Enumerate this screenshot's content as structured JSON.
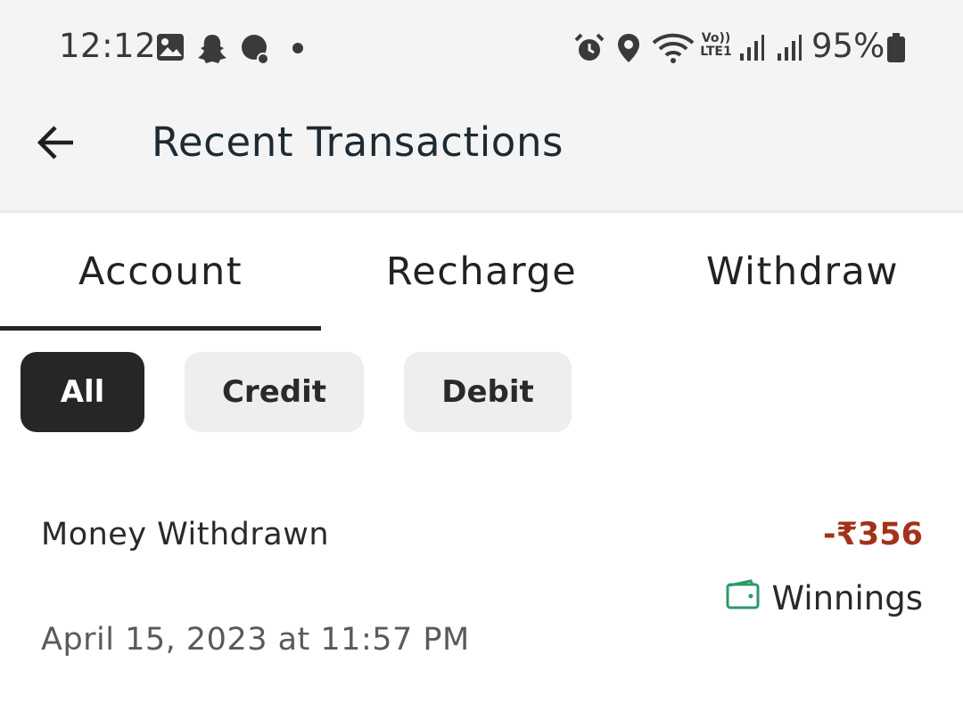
{
  "status_bar": {
    "time": "12:12",
    "battery": "95%",
    "icons": [
      "gallery-icon",
      "snapchat-icon",
      "chat-icon",
      "dot-icon",
      "alarm-icon",
      "location-icon",
      "wifi-icon",
      "volte-icon",
      "signal-icon",
      "signal-icon",
      "battery-icon"
    ],
    "volte_label": "Vo)) LTE1"
  },
  "header": {
    "title": "Recent Transactions",
    "back_icon": "arrow-left-icon"
  },
  "tabs": [
    {
      "label": "Account",
      "active": true
    },
    {
      "label": "Recharge",
      "active": false
    },
    {
      "label": "Withdraw",
      "active": false
    }
  ],
  "filters": [
    {
      "label": "All",
      "active": true
    },
    {
      "label": "Credit",
      "active": false
    },
    {
      "label": "Debit",
      "active": false
    }
  ],
  "transactions": [
    {
      "title": "Money Withdrawn",
      "amount": "-₹356",
      "wallet": "Winnings",
      "wallet_icon": "wallet-icon",
      "date": "April 15, 2023 at 11:57 PM"
    }
  ],
  "colors": {
    "debit_amount": "#a2321a",
    "wallet_icon": "#2a9a6a",
    "header_bg": "#f4f4f4",
    "active_chip": "#262626"
  }
}
